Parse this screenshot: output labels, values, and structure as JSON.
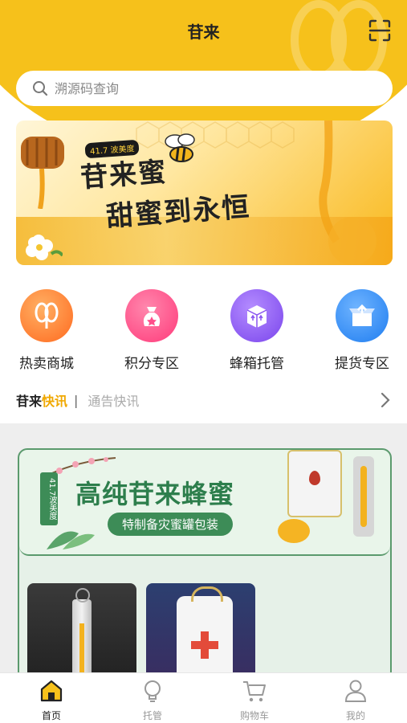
{
  "header": {
    "title": "苷来"
  },
  "search": {
    "placeholder": "溯源码查询"
  },
  "banner": {
    "badge": "41.7 波美度",
    "line1": "苷来蜜",
    "line2": "甜蜜到永恒"
  },
  "categories": [
    {
      "label": "热卖商城",
      "color": "#ff7d2b"
    },
    {
      "label": "积分专区",
      "color": "#ff4f8b"
    },
    {
      "label": "蜂箱托管",
      "color": "#8a55f0"
    },
    {
      "label": "提货专区",
      "color": "#2f8df5"
    }
  ],
  "news": {
    "prefix": "苷来",
    "highlight": "快讯",
    "separator": "|",
    "message": "通告快讯"
  },
  "promo": {
    "title": "高纯苷来蜂蜜",
    "subtitle": "特制备灾蜜罐包装",
    "tag": "41.7波美度"
  },
  "tabbar": [
    {
      "label": "首页",
      "icon": "home-icon",
      "active": true
    },
    {
      "label": "托管",
      "icon": "bulb-icon",
      "active": false
    },
    {
      "label": "购物车",
      "icon": "cart-icon",
      "active": false
    },
    {
      "label": "我的",
      "icon": "person-icon",
      "active": false
    }
  ],
  "colors": {
    "brand": "#f6c11b",
    "accent": "#f0a800",
    "green": "#3d8c57"
  }
}
